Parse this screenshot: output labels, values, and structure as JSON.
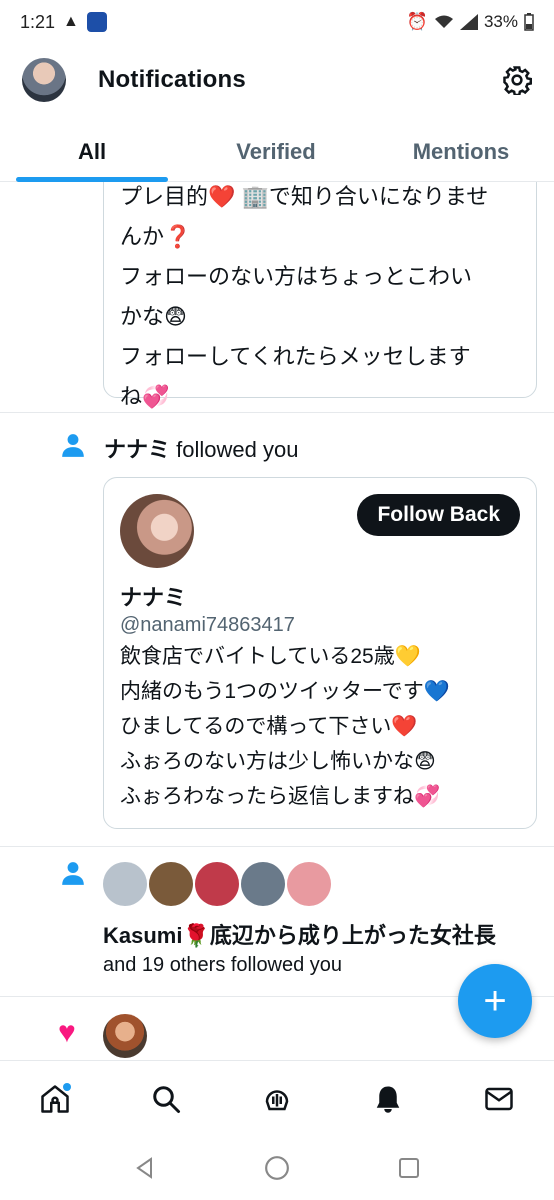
{
  "status": {
    "time": "1:21",
    "battery": "33%"
  },
  "header": {
    "title": "Notifications"
  },
  "tabs": [
    {
      "label": "All"
    },
    {
      "label": "Verified"
    },
    {
      "label": "Mentions"
    }
  ],
  "top_card": {
    "lines": [
      "プレ目的❤️ 🏢で知り合いになりませ",
      "んか❓",
      "フォローのない方はちょっとこわい",
      "かな😨",
      "フォローしてくれたらメッセします",
      "ね💞"
    ]
  },
  "follow1": {
    "name": "ナナミ",
    "action": "followed you",
    "follow_back": "Follow Back",
    "display_name": "ナナミ",
    "handle": "@nanami74863417",
    "bio": [
      "飲食店でバイトしている25歳💛",
      "内緒のもう1つのツイッターです💙",
      "ひましてるので構って下さい❤️",
      "ふぉろのない方は少し怖いかな😨",
      "ふぉろわなったら返信しますね💞"
    ]
  },
  "follow2": {
    "name": "Kasumi🌹底辺から成り上がった女社長",
    "sub": "and 19 others followed you",
    "avatar_colors": [
      "#b8c2cc",
      "#7a5a3a",
      "#c03a4a",
      "#6a7a8a",
      "#e89aa0"
    ]
  },
  "fab": {
    "label": "+"
  },
  "colors": {
    "accent": "#1d9bf0",
    "like": "#f91880"
  }
}
